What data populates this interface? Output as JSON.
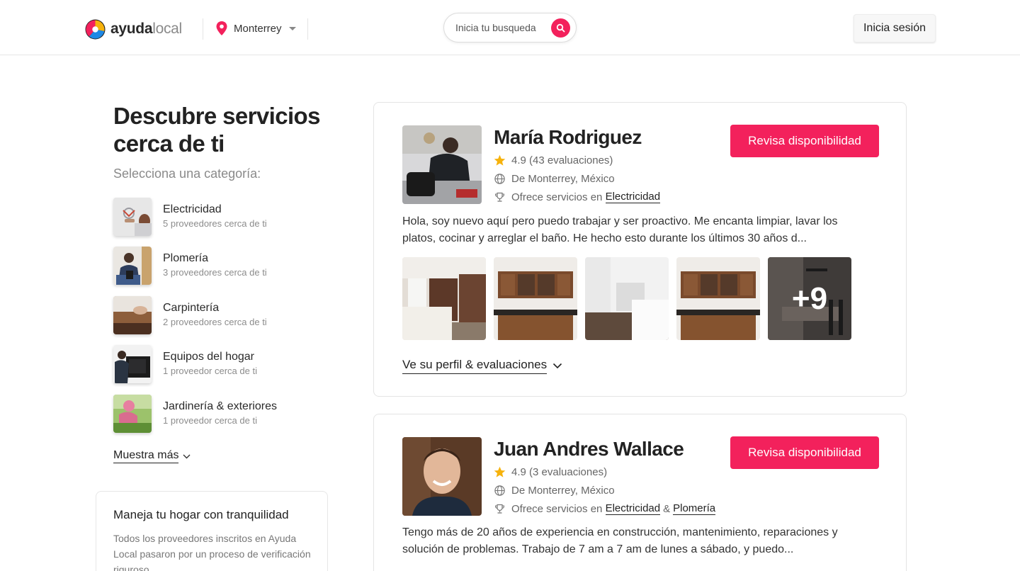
{
  "header": {
    "logo": {
      "bold": "ayuda",
      "light": "local"
    },
    "city": "Monterrey",
    "search_placeholder": "Inicia tu busqueda",
    "login_label": "Inicia sesión"
  },
  "sidebar": {
    "title": "Descubre servicios cerca de ti",
    "subhead": "Selecciona una categoría:",
    "categories": [
      {
        "name": "Electricidad",
        "count": "5 proveedores cerca de ti"
      },
      {
        "name": "Plomería",
        "count": "3 proveedores cerca de ti"
      },
      {
        "name": "Carpintería",
        "count": "2 proveedores cerca de ti"
      },
      {
        "name": "Equipos del hogar",
        "count": "1 proveedor cerca de ti"
      },
      {
        "name": "Jardinería & exteriores",
        "count": "1 proveedor cerca de ti"
      }
    ],
    "more_label": "Muestra más",
    "info": {
      "title": "Maneja tu hogar con tranquilidad",
      "text": "Todos los proveedores inscritos en Ayuda Local pasaron por un proceso de verificación riguroso."
    }
  },
  "providers": [
    {
      "name": "María Rodriguez",
      "rating": "4.9 (43 evaluaciones)",
      "location": "De Monterrey, México",
      "services_prefix": "Ofrece servicios en",
      "services": [
        "Electricidad"
      ],
      "bio": "Hola, soy nuevo aquí pero puedo trabajar y ser proactivo. Me encanta limpiar, lavar los platos, cocinar y arreglar el baño. He hecho esto durante los últimos 30 años d...",
      "more_photos": "+9",
      "availability_label": "Revisa disponibilidad",
      "profile_link": "Ve su perfil & evaluaciones"
    },
    {
      "name": "Juan Andres Wallace",
      "rating": "4.9 (3 evaluaciones)",
      "location": "De Monterrey, México",
      "services_prefix": "Ofrece servicios en",
      "services": [
        "Electricidad",
        "Plomería"
      ],
      "services_joiner": "&",
      "bio": "Tengo más de 20 años de experiencia en construcción, mantenimiento, reparaciones y solución de problemas. Trabajo de 7 am a 7 am de lunes a sábado, y puedo...",
      "availability_label": "Revisa disponibilidad"
    }
  ],
  "colors": {
    "accent": "#f3215c",
    "star": "#f6b20c"
  },
  "icons": [
    "logo-mark",
    "location-pin-icon",
    "chevron-down-icon",
    "search-icon",
    "star-icon",
    "globe-icon",
    "trophy-icon"
  ]
}
